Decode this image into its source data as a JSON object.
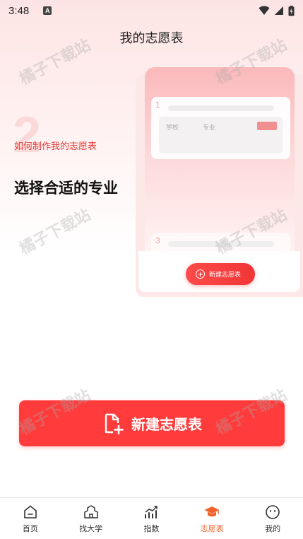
{
  "status_bar": {
    "time": "3:48",
    "notification_badge": "A"
  },
  "header": {
    "title": "我的志愿表"
  },
  "guide": {
    "step_number": "2",
    "subtitle": "如何制作我的志愿表",
    "heading": "选择合适的专业"
  },
  "mockup": {
    "card1_index": "1",
    "card3_index": "3",
    "column_school": "学校",
    "column_major": "专业",
    "button_label": "新建志愿表"
  },
  "main_action": {
    "label": "新建志愿表"
  },
  "watermark_text": "橘子下载站",
  "tabs": [
    {
      "label": "首页",
      "icon": "home-icon",
      "active": false
    },
    {
      "label": "找大学",
      "icon": "university-icon",
      "active": false
    },
    {
      "label": "指数",
      "icon": "chart-icon",
      "active": false
    },
    {
      "label": "志愿表",
      "icon": "graduation-cap-icon",
      "active": true
    },
    {
      "label": "我的",
      "icon": "profile-face-icon",
      "active": false
    }
  ],
  "colors": {
    "accent": "#ff3b3b",
    "tab_active": "#f0622a",
    "subtitle": "#e53935"
  }
}
